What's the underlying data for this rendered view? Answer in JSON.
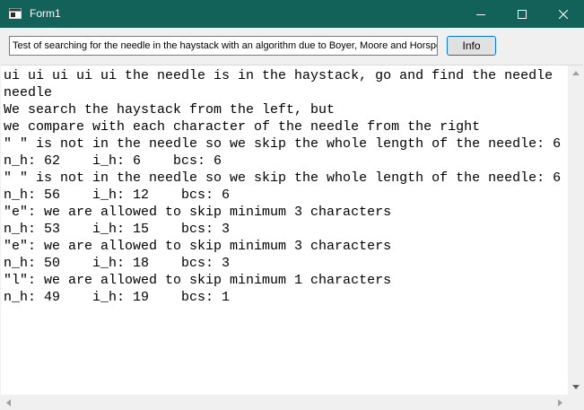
{
  "window": {
    "title": "Form1",
    "icon": "form-window-icon"
  },
  "toolbar": {
    "input_value": "Test of searching for the needle in the haystack with an algorithm due to Boyer, Moore and Horspool",
    "info_label": "Info"
  },
  "output": {
    "lines": [
      "ui ui ui ui ui the needle is in the haystack, go and find the needle",
      "needle",
      "We search the haystack from the left, but",
      "we compare with each character of the needle from the right",
      "\" \" is not in the needle so we skip the whole length of the needle: 6",
      "n_h: 62    i_h: 6    bcs: 6",
      "\" \" is not in the needle so we skip the whole length of the needle: 6",
      "n_h: 56    i_h: 12    bcs: 6",
      "\"e\": we are allowed to skip minimum 3 characters",
      "n_h: 53    i_h: 15    bcs: 3",
      "\"e\": we are allowed to skip minimum 3 characters",
      "n_h: 50    i_h: 18    bcs: 3",
      "\"l\": we are allowed to skip minimum 1 characters",
      "n_h: 49    i_h: 19    bcs: 1"
    ]
  },
  "colors": {
    "titlebar": "#13625a",
    "accent": "#0078d7"
  }
}
